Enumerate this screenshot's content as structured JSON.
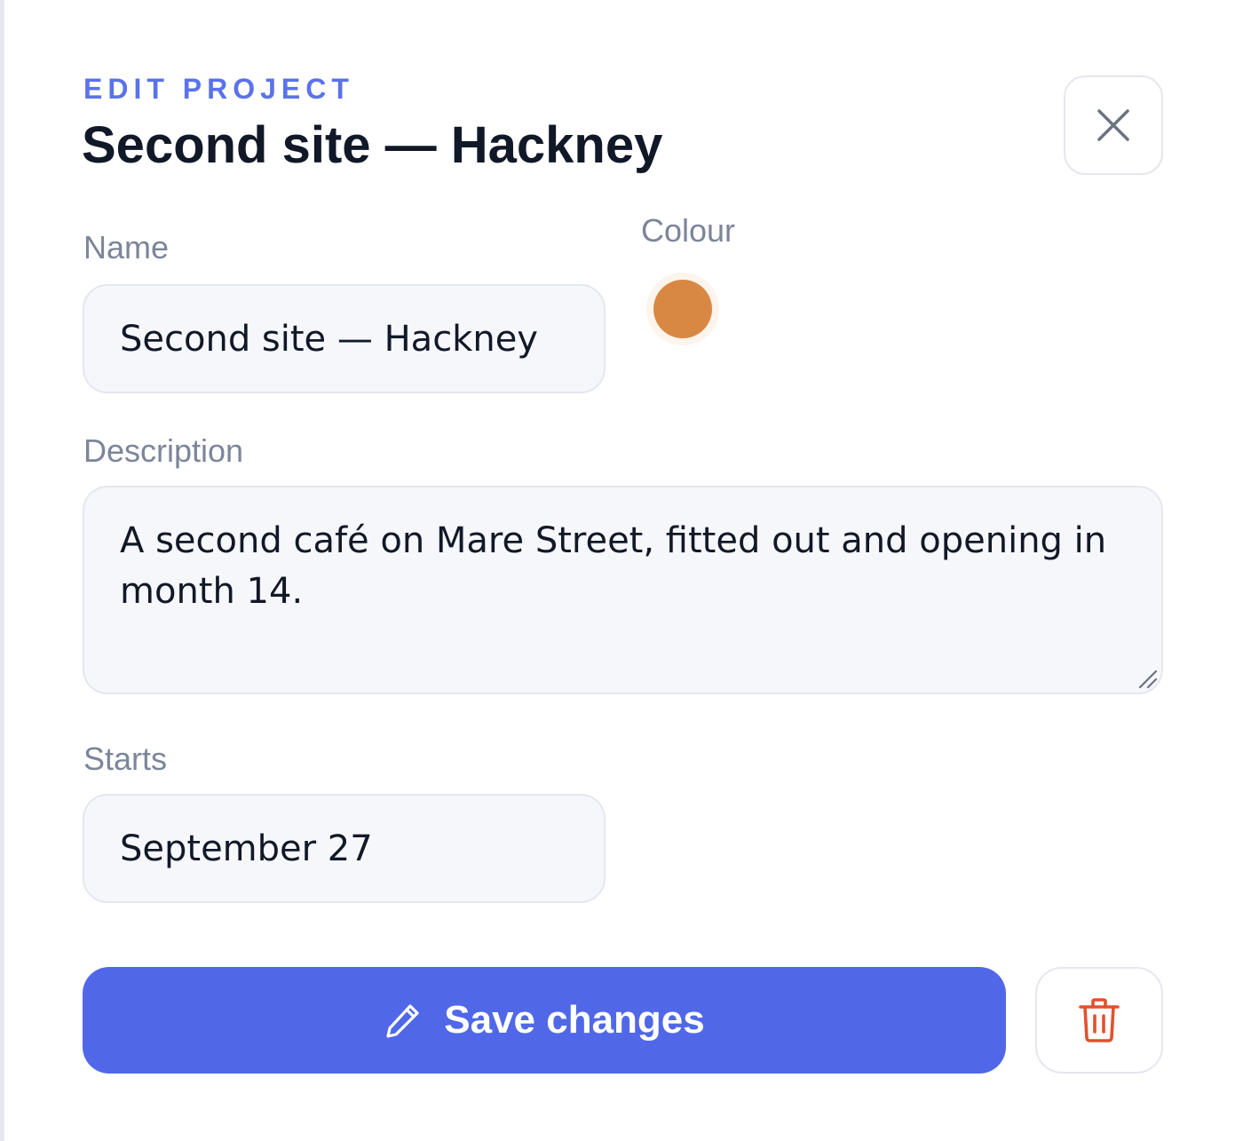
{
  "header": {
    "eyebrow": "EDIT PROJECT",
    "title": "Second site — Hackney"
  },
  "icons": {
    "close": "close-icon",
    "pencil": "pencil-icon",
    "trash": "trash-icon"
  },
  "form": {
    "name": {
      "label": "Name",
      "value": "Second site — Hackney"
    },
    "colour": {
      "label": "Colour",
      "value": "#d98843"
    },
    "description": {
      "label": "Description",
      "value": "A second café on Mare Street, fitted out and opening in month 14."
    },
    "starts": {
      "label": "Starts",
      "value": "September 27"
    }
  },
  "actions": {
    "save_label": "Save changes"
  },
  "colors": {
    "accent": "#5068e8",
    "eyebrow": "#5b72ec",
    "danger": "#e0522e"
  }
}
